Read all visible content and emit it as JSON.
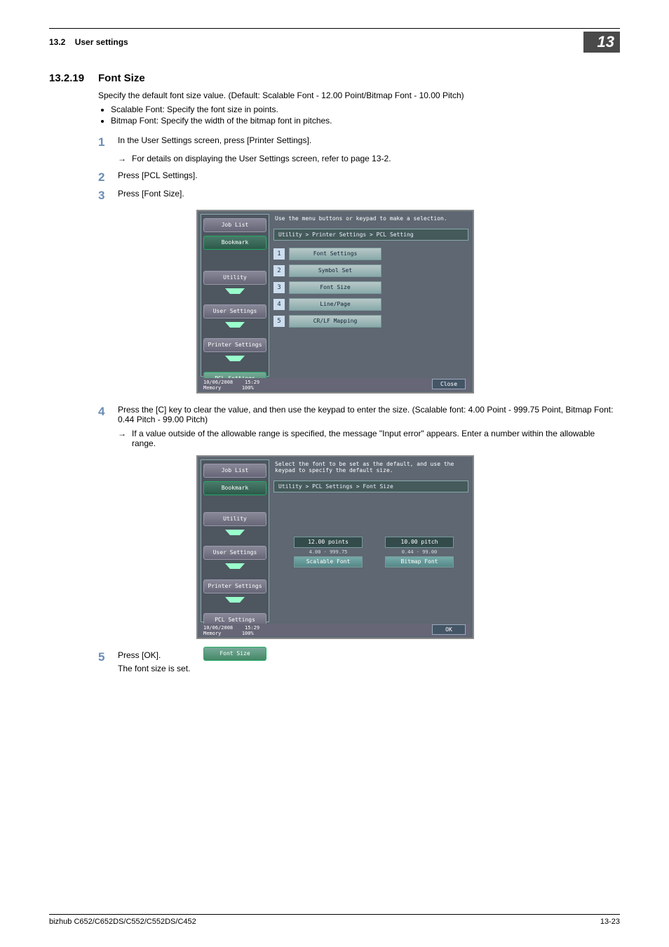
{
  "header": {
    "section_ref": "13.2",
    "section_name": "User settings",
    "chapter": "13"
  },
  "section": {
    "number": "13.2.19",
    "title": "Font Size",
    "intro": "Specify the default font size value. (Default: Scalable Font - 12.00 Point/Bitmap Font - 10.00 Pitch)",
    "bullets": [
      "Scalable Font: Specify the font size in points.",
      "Bitmap Font: Specify the width of the bitmap font in pitches."
    ]
  },
  "steps": {
    "s1": "In the User Settings screen, press [Printer Settings].",
    "s1_sub": "For details on displaying the User Settings screen, refer to page 13-2.",
    "s2": "Press [PCL Settings].",
    "s3": "Press [Font Size].",
    "s4": "Press the [C] key to clear the value, and then use the keypad to enter the size. (Scalable font: 4.00 Point - 999.75 Point, Bitmap Font: 0.44 Pitch - 99.00 Pitch)",
    "s4_sub": "If a value outside of the allowable range is specified, the message \"Input error\" appears. Enter a number within the allowable range.",
    "s5": "Press [OK].",
    "s5_after": "The font size is set."
  },
  "screen1": {
    "job_list": "Job List",
    "bookmark": "Bookmark",
    "nav": [
      "Utility",
      "User Settings",
      "Printer Settings",
      "PCL Settings"
    ],
    "instr": "Use the menu buttons or keypad to make a selection.",
    "path": "Utility > Printer Settings > PCL Setting",
    "items": [
      {
        "n": "1",
        "label": "Font Settings"
      },
      {
        "n": "2",
        "label": "Symbol Set"
      },
      {
        "n": "3",
        "label": "Font Size"
      },
      {
        "n": "4",
        "label": "Line/Page"
      },
      {
        "n": "5",
        "label": "CR/LF Mapping"
      }
    ],
    "date": "10/06/2008",
    "time": "15:29",
    "mem": "Memory",
    "pct": "100%",
    "close": "Close"
  },
  "screen2": {
    "job_list": "Job List",
    "bookmark": "Bookmark",
    "nav": [
      "Utility",
      "User Settings",
      "Printer Settings",
      "PCL Settings",
      "Font Size"
    ],
    "instr": "Select the font to be set as the default, and use the keypad to specify the default size.",
    "path": "Utility > PCL Settings > Font Size",
    "scalable": {
      "value": "12.00 points",
      "range": "4.00 - 999.75",
      "label": "Scalable Font"
    },
    "bitmap": {
      "value": "10.00 pitch",
      "range": "0.44 - 99.00",
      "label": "Bitmap Font"
    },
    "date": "10/06/2008",
    "time": "15:29",
    "mem": "Memory",
    "pct": "100%",
    "ok": "OK"
  },
  "footer": {
    "model": "bizhub C652/C652DS/C552/C552DS/C452",
    "page": "13-23"
  }
}
